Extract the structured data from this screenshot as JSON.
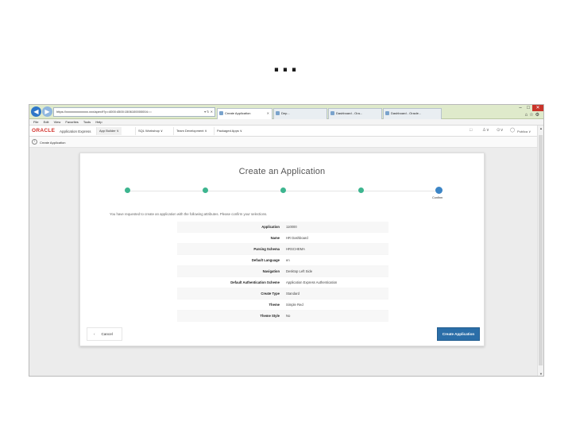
{
  "slide": {
    "ellipsis": "..."
  },
  "browser": {
    "url": "https://xxxxxxxxxxxxxx.xxx/apex/f?p=4000:4500:1506100000004:::::",
    "url_controls": "▾ ↻ ✕",
    "tabs": [
      "Create Application",
      "Dep...",
      "Dashboard - Ora...",
      "Dashboard - Oracle..."
    ],
    "menu": [
      "File",
      "Edit",
      "View",
      "Favorites",
      "Tools",
      "Help"
    ],
    "window_controls": {
      "minimize": "–",
      "maximize": "□",
      "close": "✕"
    }
  },
  "apex": {
    "logo": "ORACLE",
    "app_name": "Application Express",
    "nav": [
      "App Builder ∨",
      "SQL Workshop ∨",
      "Team Development ∨",
      "Packaged Apps ∨"
    ],
    "right": {
      "user": "Publica ∨"
    },
    "breadcrumb": "Create Application"
  },
  "dialog": {
    "title": "Create an Application",
    "steps": [
      "",
      "",
      "",
      "",
      ""
    ],
    "current_step_label": "Confirm",
    "intro": "You have requested to create an application with the following attributes. Please confirm your selections.",
    "summary": [
      {
        "label": "Application",
        "value": "110000"
      },
      {
        "label": "Name",
        "value": "HR Dashboard"
      },
      {
        "label": "Parsing Schema",
        "value": "HRSCHEMA"
      },
      {
        "label": "Default Language",
        "value": "en"
      },
      {
        "label": "Navigation",
        "value": "Desktop Left Side"
      },
      {
        "label": "Default Authentication Scheme",
        "value": "Application Express Authentication"
      },
      {
        "label": "Create Type",
        "value": "Standard"
      },
      {
        "label": "Theme",
        "value": "Simple Red"
      },
      {
        "label": "Theme Style",
        "value": "No"
      }
    ],
    "cancel_label": "Cancel",
    "create_label": "Create Application"
  },
  "colors": {
    "accent": "#2b6ea8",
    "done_step": "#3db58f",
    "oracle_red": "#d2302a"
  }
}
